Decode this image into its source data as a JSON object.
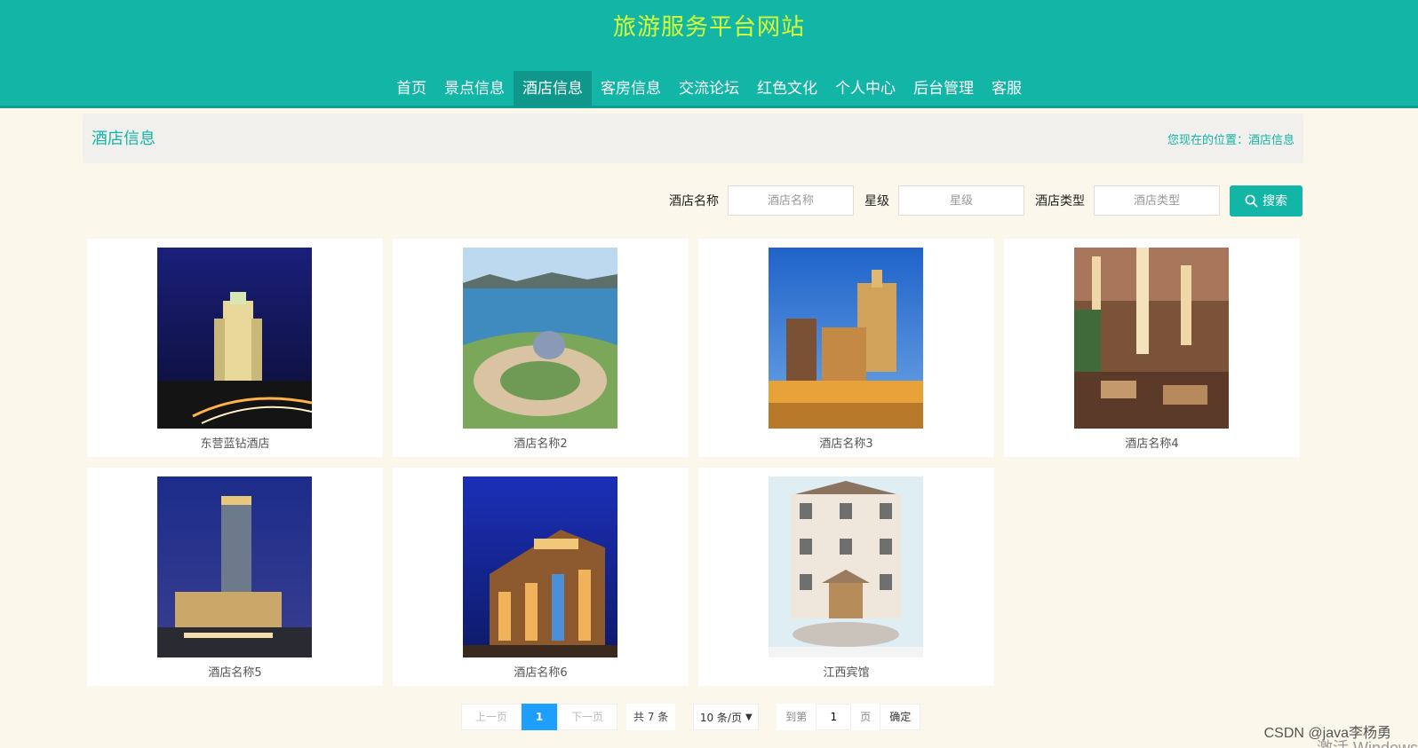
{
  "header": {
    "site_title": "旅游服务平台网站",
    "nav": [
      {
        "label": "首页",
        "active": false
      },
      {
        "label": "景点信息",
        "active": false
      },
      {
        "label": "酒店信息",
        "active": true
      },
      {
        "label": "客房信息",
        "active": false
      },
      {
        "label": "交流论坛",
        "active": false
      },
      {
        "label": "红色文化",
        "active": false
      },
      {
        "label": "个人中心",
        "active": false
      },
      {
        "label": "后台管理",
        "active": false
      },
      {
        "label": "客服",
        "active": false
      }
    ]
  },
  "title_bar": {
    "title": "酒店信息",
    "breadcrumb": "您现在的位置：酒店信息"
  },
  "search": {
    "name_label": "酒店名称",
    "name_placeholder": "酒店名称",
    "star_label": "星级",
    "star_placeholder": "星级",
    "type_label": "酒店类型",
    "type_placeholder": "酒店类型",
    "button_label": "搜索"
  },
  "hotels": [
    {
      "name": "东营蓝钻酒店",
      "image": "night-hotel-tower"
    },
    {
      "name": "酒店名称2",
      "image": "seaside-hotel-dome"
    },
    {
      "name": "酒店名称3",
      "image": "casino-resort-hotel"
    },
    {
      "name": "酒店名称4",
      "image": "hotel-lobby-chandelier"
    },
    {
      "name": "酒店名称5",
      "image": "tall-hotel-night"
    },
    {
      "name": "酒店名称6",
      "image": "lit-hotel-facade"
    },
    {
      "name": "江西宾馆",
      "image": "classic-hotel-building"
    }
  ],
  "pagination": {
    "prev": "上一页",
    "current": "1",
    "next": "下一页",
    "total": "共 7 条",
    "page_size": "10 条/页",
    "goto_label": "到第",
    "goto_value": "1",
    "page_unit": "页",
    "confirm": "确定"
  },
  "watermark": "CSDN @java李杨勇",
  "os_overlay": "激活 Windows",
  "colors": {
    "primary": "#12b5a6",
    "title": "#d8ff33",
    "page_current": "#1e9fff"
  }
}
